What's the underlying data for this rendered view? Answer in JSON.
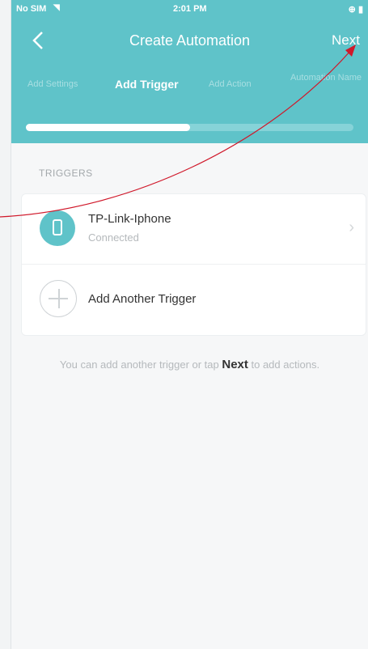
{
  "status_bar": {
    "carrier": "No SIM",
    "time": "2:01 PM",
    "battery": "⊕ ▮"
  },
  "nav": {
    "title": "Create Automation",
    "next_label": "Next"
  },
  "steps": [
    {
      "label": "Add Settings"
    },
    {
      "label": "Add Trigger"
    },
    {
      "label": "Add Action"
    },
    {
      "label": "Automation Name"
    }
  ],
  "progress": {
    "fraction": 0.5
  },
  "triggers": {
    "section_label": "TRIGGERS",
    "device": {
      "name": "TP-Link-Iphone",
      "status": "Connected"
    },
    "add_label": "Add Another Trigger"
  },
  "hint": {
    "prefix": "You can add another trigger or tap ",
    "bold": "Next",
    "suffix": " to add actions."
  },
  "colors": {
    "accent": "#5fc3c9",
    "annotation": "#d0182a"
  }
}
